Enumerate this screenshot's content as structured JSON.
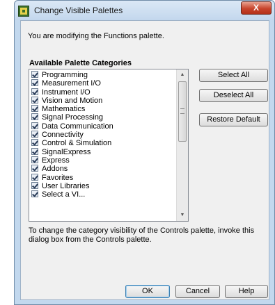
{
  "window": {
    "title": "Change Visible Palettes",
    "close_glyph": "X"
  },
  "message": "You are modifying the Functions palette.",
  "categories_heading": "Available Palette Categories",
  "categories": [
    {
      "label": "Programming",
      "checked": true
    },
    {
      "label": "Measurement I/O",
      "checked": true
    },
    {
      "label": "Instrument I/O",
      "checked": true
    },
    {
      "label": "Vision and Motion",
      "checked": true
    },
    {
      "label": "Mathematics",
      "checked": true
    },
    {
      "label": "Signal Processing",
      "checked": true
    },
    {
      "label": "Data Communication",
      "checked": true
    },
    {
      "label": "Connectivity",
      "checked": true
    },
    {
      "label": "Control & Simulation",
      "checked": true
    },
    {
      "label": "SignalExpress",
      "checked": true
    },
    {
      "label": "Express",
      "checked": true
    },
    {
      "label": "Addons",
      "checked": true
    },
    {
      "label": "Favorites",
      "checked": true
    },
    {
      "label": "User Libraries",
      "checked": true
    },
    {
      "label": "Select a VI...",
      "checked": true
    }
  ],
  "buttons": {
    "select_all": "Select All",
    "deselect_all": "Deselect All",
    "restore_default": "Restore Default",
    "ok": "OK",
    "cancel": "Cancel",
    "help": "Help"
  },
  "note": "To change the category visibility of the Controls palette, invoke this dialog box from the Controls palette.",
  "icons": {
    "app": "labview-app-icon",
    "scroll_up": "▲",
    "scroll_down": "▼"
  }
}
